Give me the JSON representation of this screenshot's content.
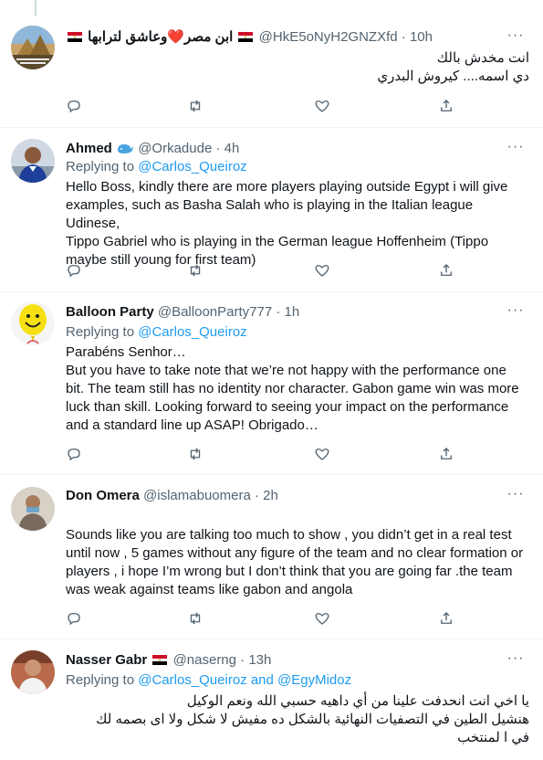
{
  "tweets": [
    {
      "name": "ابن مصر❤️وعاشق لترابها",
      "handle": "@HkE5oNyH2GNZXfd",
      "dot": "·",
      "time": "10h",
      "replying_prefix": "",
      "replying_to": "",
      "lines": [
        "انت مخدش بالك",
        "دي اسمه.... كيروش البدري"
      ],
      "avatar_icon": "pyramids-avatar"
    },
    {
      "name": "Ahmed",
      "handle": "@Orkadude",
      "dot": "·",
      "time": "4h",
      "replying_prefix": "Replying to",
      "replying_to": "@Carlos_Queiroz",
      "lines": [
        "Hello Boss, kindly there are more players playing outside Egypt i will give",
        "examples, such as Basha Salah who is playing in the Italian league Udinese,",
        "Tippo Gabriel who is playing in the German league Hoffenheim (Tippo",
        "maybe still young for first team)"
      ],
      "avatar_icon": "football-player-avatar"
    },
    {
      "name": "Balloon Party",
      "handle": "@BalloonParty777",
      "dot": "·",
      "time": "1h",
      "replying_prefix": "Replying to",
      "replying_to": "@Carlos_Queiroz",
      "lines": [
        "Parabéns Senhor…",
        "But you have to take note that we’re not happy with the performance one",
        "bit. The team still has no identity nor character. Gabon game win was more",
        "luck than skill. Looking forward to seeing your impact on the performance",
        "and a standard line up ASAP! Obrigado…"
      ],
      "avatar_icon": "smiley-balloon-avatar"
    },
    {
      "name": "Don Omera",
      "handle": "@islamabuomera",
      "dot": "·",
      "time": "2h",
      "replying_prefix": "Replying to",
      "replying_to": "@Carlos_Queiroz",
      "lines": [
        "Sounds like you are talking too much to show , you didn’t get in a real test",
        "until now , 5 games without any figure of the team and no clear formation or",
        "players , i hope I’m wrong but I don’t think that you are going far .the team",
        "was weak against teams like gabon and angola"
      ],
      "avatar_icon": "person-avatar"
    },
    {
      "name": "Nasser Gabr",
      "handle": "@naserng",
      "dot": "·",
      "time": "13h",
      "replying_prefix": "Replying to",
      "replying_to": "@Carlos_Queiroz and @EgyMidoz",
      "lines": [
        "يا اخي انت انحدفت علينا من أي داهيه حسبي الله ونعم الوكيل",
        "هنشيل الطين في التصفيات النهائية بالشكل ده مفيش لا شكل ولا اى بصمه لك",
        "في ا لمنتخب"
      ],
      "avatar_icon": "man-portrait-avatar"
    }
  ],
  "action_icons": [
    "reply-icon",
    "retweet-icon",
    "like-icon",
    "share-icon"
  ],
  "more_label": "···",
  "colors": {
    "accent": "#1d9bf0",
    "secondary_text": "#536471",
    "divider": "#eff3f4"
  }
}
